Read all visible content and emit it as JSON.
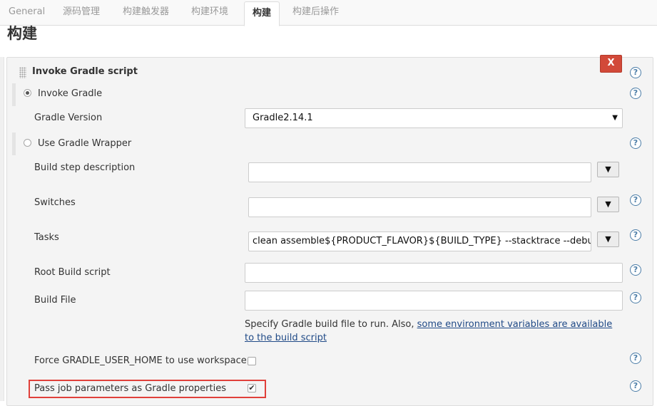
{
  "tabs": [
    {
      "label": "General"
    },
    {
      "label": "源码管理"
    },
    {
      "label": "构建触发器"
    },
    {
      "label": "构建环境"
    },
    {
      "label": "构建"
    },
    {
      "label": "构建后操作"
    }
  ],
  "section_title": "构建",
  "step": {
    "title": "Invoke Gradle script",
    "delete_label": "X"
  },
  "invoke_gradle": {
    "radio_label": "Invoke Gradle",
    "selected": true,
    "gradle_version_label": "Gradle Version",
    "gradle_version_value": "Gradle2.14.1"
  },
  "use_wrapper": {
    "radio_label": "Use Gradle Wrapper",
    "selected": false
  },
  "fields": {
    "build_step_description": {
      "label": "Build step description",
      "value": ""
    },
    "switches": {
      "label": "Switches",
      "value": ""
    },
    "tasks": {
      "label": "Tasks",
      "value": "clean assemble${PRODUCT_FLAVOR}${BUILD_TYPE} --stacktrace --debug"
    },
    "root_build_script": {
      "label": "Root Build script",
      "value": ""
    },
    "build_file": {
      "label": "Build File",
      "value": ""
    }
  },
  "build_file_help": {
    "text": "Specify Gradle build file to run. Also, ",
    "link": "some environment variables are available to the build script"
  },
  "force_home": {
    "label": "Force GRADLE_USER_HOME to use workspace",
    "checked": false
  },
  "pass_params": {
    "label": "Pass job parameters as Gradle properties",
    "checked": true
  },
  "icons": {
    "help": "?",
    "expand": "▼",
    "caret": "▼",
    "check": "✔"
  },
  "colors": {
    "delete_button": "#d24939",
    "highlight_border": "#e0403a",
    "link": "#204a87",
    "help_icon": "#4d7ea8"
  }
}
